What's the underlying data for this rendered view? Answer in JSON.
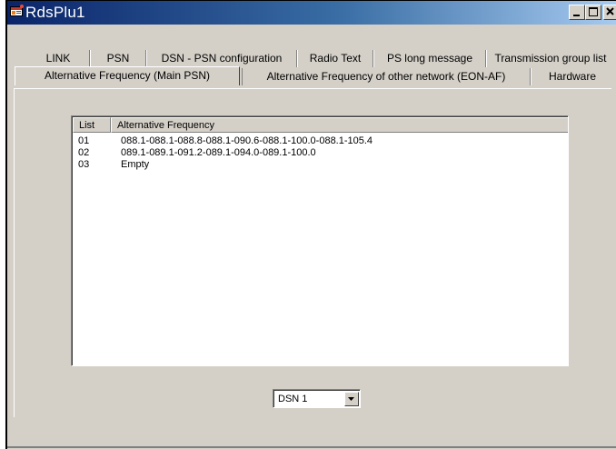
{
  "window": {
    "title": "RdsPlu1"
  },
  "tabs_row1": [
    {
      "label": "LINK"
    },
    {
      "label": "PSN"
    },
    {
      "label": "DSN - PSN configuration"
    },
    {
      "label": "Radio Text"
    },
    {
      "label": "PS long message"
    },
    {
      "label": "Transmission group list"
    }
  ],
  "tabs_row2": [
    {
      "label": "Alternative Frequency (Main PSN)",
      "selected": true
    },
    {
      "label": "Alternative Frequency of other network (EON-AF)",
      "selected": false
    },
    {
      "label": "Hardware",
      "selected": false
    }
  ],
  "af_list": {
    "columns": [
      "List",
      "Alternative Frequency"
    ],
    "rows": [
      {
        "list": "01",
        "frequency": "088.1-088.1-088.8-088.1-090.6-088.1-100.0-088.1-105.4"
      },
      {
        "list": "02",
        "frequency": "089.1-089.1-091.2-089.1-094.0-089.1-100.0"
      },
      {
        "list": "03",
        "frequency": "Empty"
      }
    ]
  },
  "dsn_select": {
    "value": "DSN 1"
  },
  "icons": {
    "app": "app-icon",
    "minimize": "minimize-icon",
    "maximize": "maximize-icon",
    "close": "close-icon",
    "dropdown": "chevron-down-icon"
  },
  "colors": {
    "titlebar_start": "#0a246a",
    "titlebar_end": "#a6caf0",
    "face": "#d4d0c8"
  }
}
